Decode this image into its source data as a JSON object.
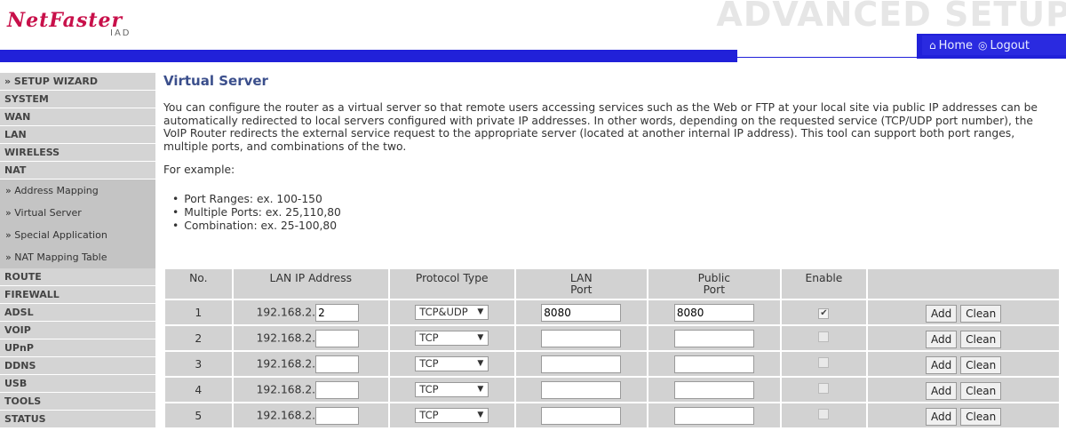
{
  "header": {
    "logo_main": "NetFaster",
    "logo_sub": "IAD",
    "banner_title": "ADVANCED SETUP",
    "home_label": "Home",
    "logout_label": "Logout"
  },
  "sidebar": {
    "items": [
      {
        "label": "» SETUP WIZARD"
      },
      {
        "label": "SYSTEM"
      },
      {
        "label": "WAN"
      },
      {
        "label": "LAN"
      },
      {
        "label": "WIRELESS"
      },
      {
        "label": "NAT"
      }
    ],
    "nat_sub": [
      {
        "label": "» Address Mapping"
      },
      {
        "label": "» Virtual Server"
      },
      {
        "label": "» Special Application"
      },
      {
        "label": "» NAT Mapping Table"
      }
    ],
    "items_after": [
      {
        "label": "ROUTE"
      },
      {
        "label": "FIREWALL"
      },
      {
        "label": "ADSL"
      },
      {
        "label": "VOIP"
      },
      {
        "label": "UPnP"
      },
      {
        "label": "DDNS"
      },
      {
        "label": "USB"
      },
      {
        "label": "TOOLS"
      },
      {
        "label": "STATUS"
      }
    ]
  },
  "main": {
    "title": "Virtual Server",
    "description": "You can configure the router as a virtual server so that remote users accessing services such as the Web or FTP at your local site via public IP addresses can be automatically redirected to local servers configured with private IP addresses. In other words, depending on the requested service (TCP/UDP port number), the VoIP Router redirects the external service request to the appropriate server (located at another internal IP address). This tool can support both port ranges, multiple ports, and combinations of the two.",
    "example_label": "For example:",
    "examples": [
      "Port Ranges: ex. 100-150",
      "Multiple Ports: ex. 25,110,80",
      "Combination: ex. 25-100,80"
    ]
  },
  "table": {
    "headers": {
      "no": "No.",
      "lan_ip": "LAN IP Address",
      "protocol": "Protocol Type",
      "lan_port_1": "LAN",
      "lan_port_2": "Port",
      "public_port_1": "Public",
      "public_port_2": "Port",
      "enable": "Enable"
    },
    "ip_prefix": "192.168.2.",
    "add_label": "Add",
    "clean_label": "Clean",
    "rows": [
      {
        "no": "1",
        "ip_suffix": "2",
        "protocol": "TCP&UDP",
        "lan_port": "8080",
        "public_port": "8080",
        "enabled": true
      },
      {
        "no": "2",
        "ip_suffix": "",
        "protocol": "TCP",
        "lan_port": "",
        "public_port": "",
        "enabled": false
      },
      {
        "no": "3",
        "ip_suffix": "",
        "protocol": "TCP",
        "lan_port": "",
        "public_port": "",
        "enabled": false
      },
      {
        "no": "4",
        "ip_suffix": "",
        "protocol": "TCP",
        "lan_port": "",
        "public_port": "",
        "enabled": false
      },
      {
        "no": "5",
        "ip_suffix": "",
        "protocol": "TCP",
        "lan_port": "",
        "public_port": "",
        "enabled": false
      }
    ]
  }
}
